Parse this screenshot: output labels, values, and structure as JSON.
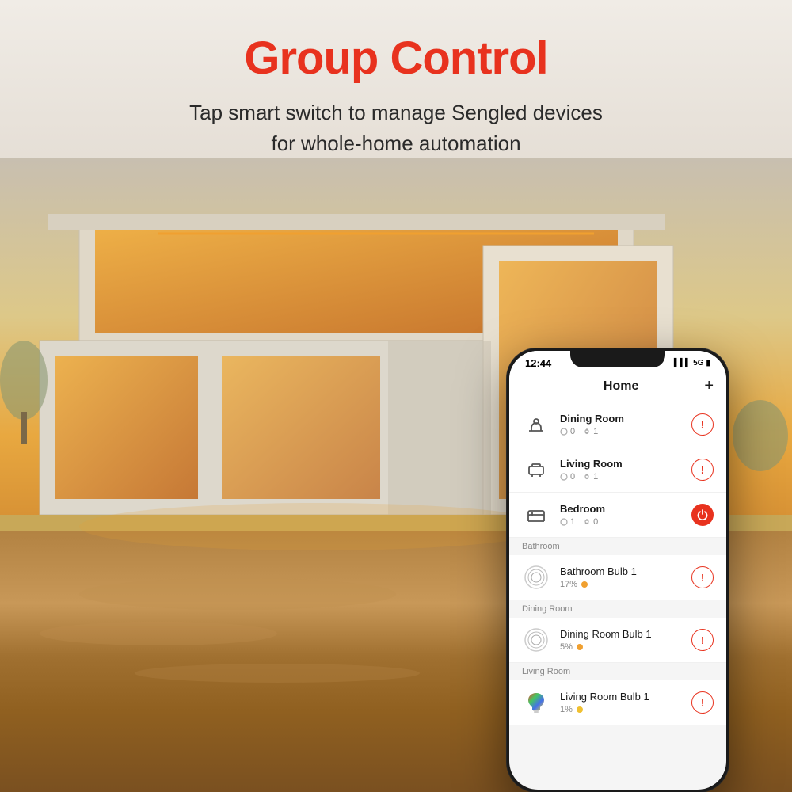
{
  "page": {
    "background_color": "#e8e0d8"
  },
  "header": {
    "title": "Group Control",
    "subtitle_line1": "Tap smart switch to manage Sengled devices",
    "subtitle_line2": "for whole-home automation"
  },
  "phone": {
    "status_bar": {
      "time": "12:44",
      "signal": "▌▌▌",
      "network": "5G",
      "battery": "🔋"
    },
    "app_header": {
      "title": "Home",
      "add_button": "+"
    },
    "rooms": [
      {
        "name": "Dining Room",
        "icon": "🍽",
        "stat1": "0",
        "stat2": "1",
        "action": "alert"
      },
      {
        "name": "Living Room",
        "icon": "🛋",
        "stat1": "0",
        "stat2": "1",
        "action": "alert"
      },
      {
        "name": "Bedroom",
        "icon": "🛏",
        "stat1": "1",
        "stat2": "0",
        "action": "power"
      }
    ],
    "sections": [
      {
        "label": "Bathroom",
        "devices": [
          {
            "name": "Bathroom Bulb 1",
            "brightness": "17%",
            "dot_color": "orange",
            "action": "alert"
          }
        ]
      },
      {
        "label": "Dining Room",
        "devices": [
          {
            "name": "Dining Room Bulb 1",
            "brightness": "5%",
            "dot_color": "orange",
            "action": "alert"
          }
        ]
      },
      {
        "label": "Living Room",
        "devices": [
          {
            "name": "Living Room Bulb 1",
            "brightness": "1%",
            "dot_color": "multi",
            "action": "alert"
          }
        ]
      }
    ]
  }
}
